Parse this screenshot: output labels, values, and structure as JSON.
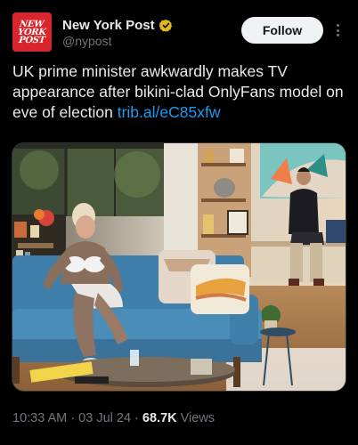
{
  "account": {
    "display_name": "New York Post",
    "handle": "@nypost",
    "avatar_lines": [
      "NEW",
      "YORK",
      "POST"
    ],
    "verified_icon": "gold-verified-badge",
    "brand_color": "#d9262c",
    "verified_color": "#e2b719"
  },
  "actions": {
    "follow_label": "Follow",
    "more_icon": "more-vertical-icon"
  },
  "tweet": {
    "text": "UK prime minister awkwardly makes TV appearance after bikini-clad OnlyFans model on eve of election ",
    "link": "trib.al/eC85xfw",
    "link_color": "#1d9bf0"
  },
  "media": {
    "kind": "photo"
  },
  "meta": {
    "time": "10:33 AM",
    "separator": " · ",
    "date": "03 Jul 24",
    "views_count": "68.7K",
    "views_label": "Views"
  }
}
